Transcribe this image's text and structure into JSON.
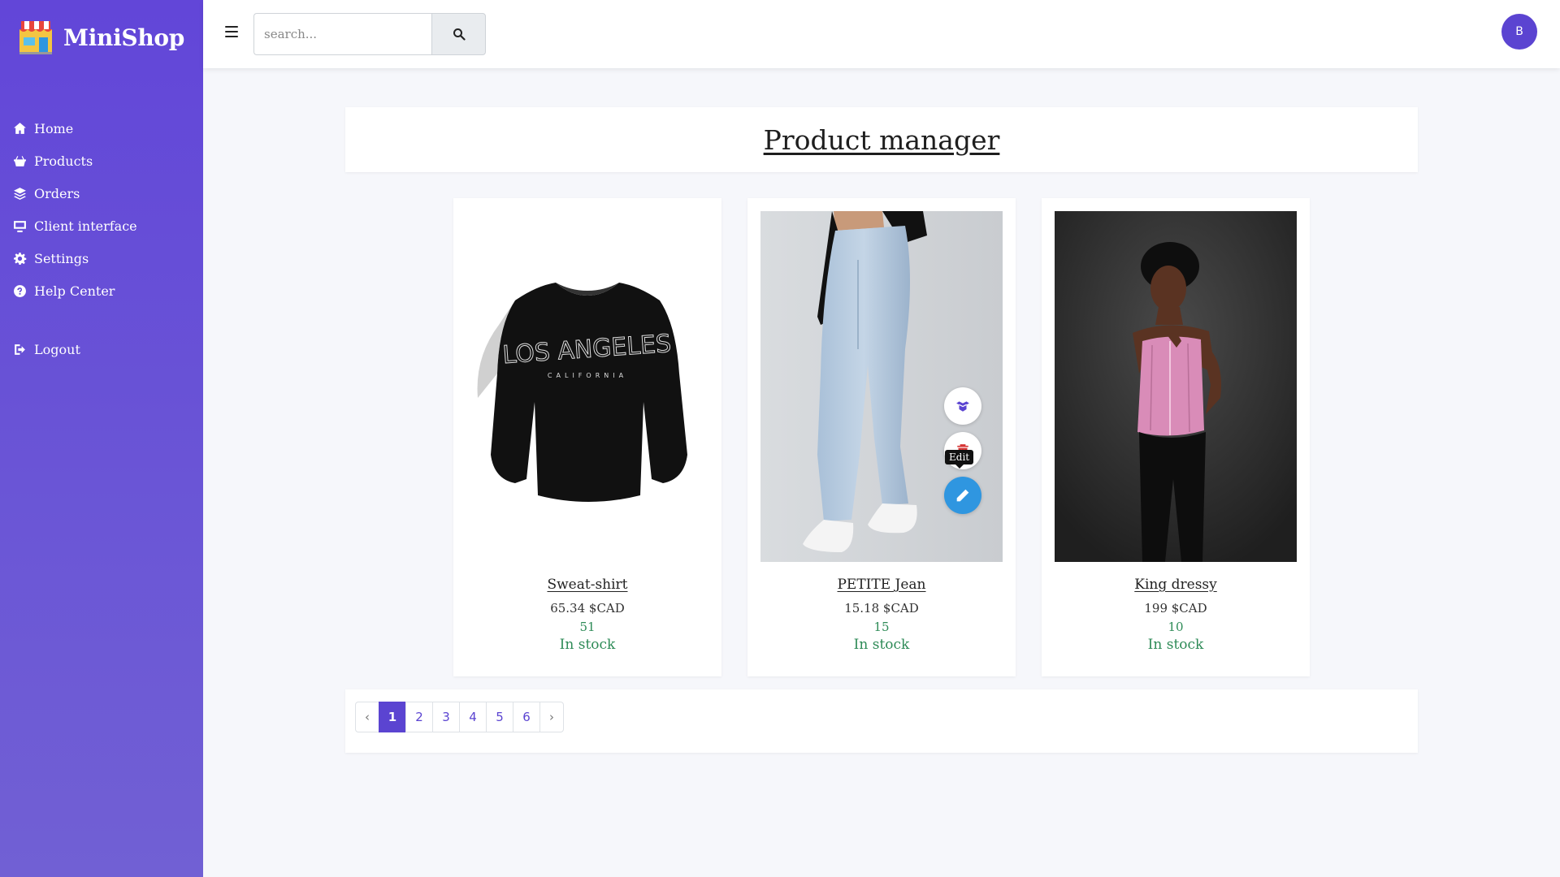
{
  "app": {
    "name": "MiniShop"
  },
  "sidebar": {
    "items": [
      {
        "label": "Home",
        "icon": "home-icon"
      },
      {
        "label": "Products",
        "icon": "basket-icon"
      },
      {
        "label": "Orders",
        "icon": "layers-icon"
      },
      {
        "label": "Client interface",
        "icon": "monitor-icon"
      },
      {
        "label": "Settings",
        "icon": "gear-icon"
      },
      {
        "label": "Help Center",
        "icon": "question-circle-icon"
      }
    ],
    "logout": {
      "label": "Logout",
      "icon": "logout-icon"
    }
  },
  "topbar": {
    "search_placeholder": "search...",
    "search_value": "",
    "avatar_initial": "B"
  },
  "page": {
    "title": "Product manager"
  },
  "products": [
    {
      "name": "Sweat-shirt",
      "price": "65.34 $CAD",
      "quantity": "51",
      "status": "In stock"
    },
    {
      "name": "PETITE Jean",
      "price": "15.18 $CAD",
      "quantity": "15",
      "status": "In stock"
    },
    {
      "name": "King dressy",
      "price": "199 $CAD",
      "quantity": "10",
      "status": "In stock"
    }
  ],
  "hover_actions": {
    "tooltip": "Edit"
  },
  "pagination": {
    "prev": "‹",
    "next": "›",
    "pages": [
      "1",
      "2",
      "3",
      "4",
      "5",
      "6"
    ],
    "active": "1"
  },
  "colors": {
    "sidebar": "#6246d8",
    "accent": "#5b44d1",
    "edit_button": "#2f96e0",
    "in_stock": "#2e8b57"
  }
}
